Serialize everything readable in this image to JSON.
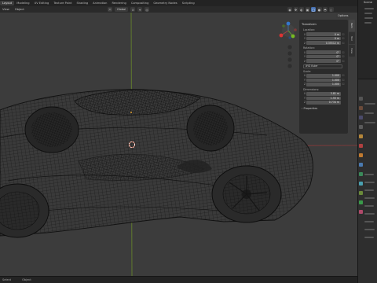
{
  "workspaces": [
    "Layout",
    "Modeling",
    "UV Editing",
    "Texture Paint",
    "Shading",
    "Animation",
    "Rendering",
    "Compositing",
    "Geometry Nodes",
    "Scripting"
  ],
  "active_workspace": "Layout",
  "header": {
    "menus": [
      "View",
      "Object"
    ],
    "orientation": "Global",
    "options_label": "Options"
  },
  "npanel": {
    "title": "Transform",
    "location_label": "Location:",
    "location": [
      "0 m",
      "0 m",
      "0.35512 m"
    ],
    "rotation_label": "Rotation:",
    "rotation": [
      "0°",
      "0°",
      "0°"
    ],
    "rotation_mode": "XYZ Euler",
    "scale_label": "Scale:",
    "scale": [
      "1.000",
      "1.000",
      "1.000"
    ],
    "dimensions_label": "Dimensions:",
    "dimensions": [
      "3.81 m",
      "1.55 m",
      "0.734 m"
    ],
    "axes": [
      "X",
      "Y",
      "Z"
    ],
    "properties_label": "Properties"
  },
  "ntabs": [
    "Item",
    "Tool",
    "View"
  ],
  "outliner_title": "Scene",
  "status_items": [
    "Select",
    "Object"
  ],
  "colors": {
    "accent": "#4772b3",
    "wire": "#0a0a0a",
    "x_axis": "#8a3a3a",
    "y_axis": "#6a8a2a"
  }
}
